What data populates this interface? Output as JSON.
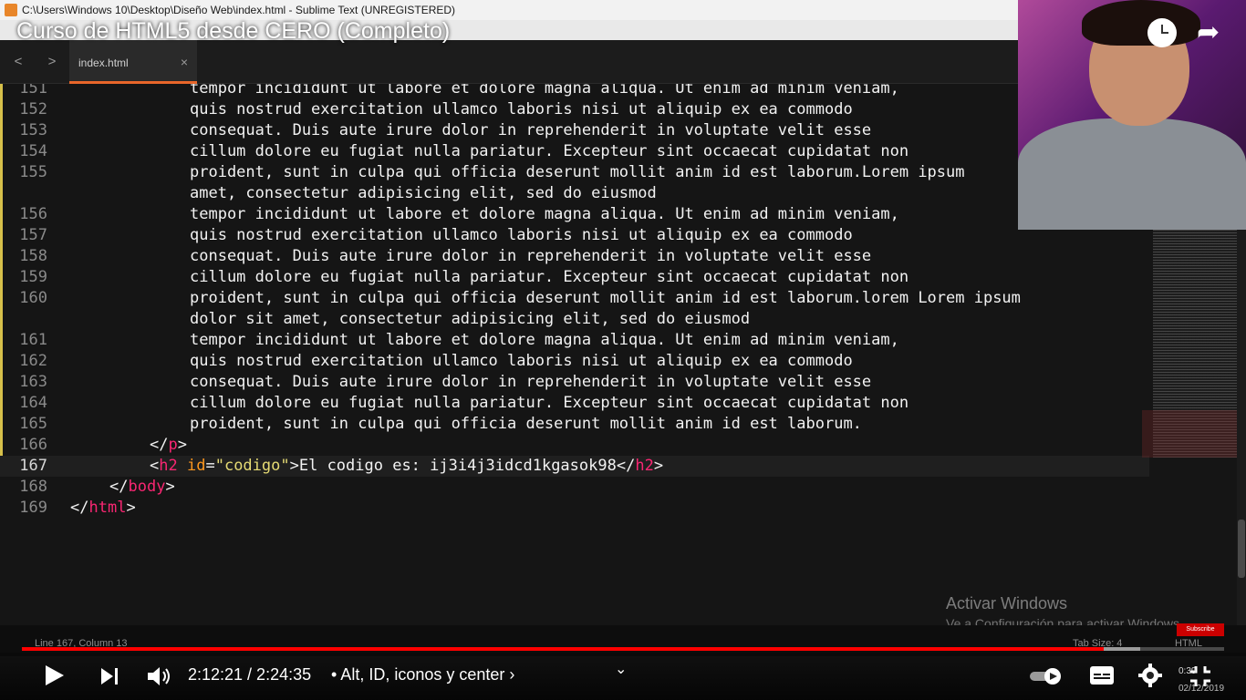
{
  "window": {
    "title": "C:\\Users\\Windows 10\\Desktop\\Diseño Web\\index.html - Sublime Text (UNREGISTERED)",
    "tab_label": "index.html",
    "tab_close": "×",
    "nav_back": "<",
    "nav_forward": ">"
  },
  "editor": {
    "lines": [
      {
        "num": "151",
        "text": "tempor incididunt ut labore et dolore magna aliqua. Ut enim ad minim veniam,"
      },
      {
        "num": "152",
        "text": "quis nostrud exercitation ullamco laboris nisi ut aliquip ex ea commodo"
      },
      {
        "num": "153",
        "text": "consequat. Duis aute irure dolor in reprehenderit in voluptate velit esse"
      },
      {
        "num": "154",
        "text": "cillum dolore eu fugiat nulla pariatur. Excepteur sint occaecat cupidatat non"
      },
      {
        "num": "155",
        "text": "proident, sunt in culpa qui officia deserunt mollit anim id est laborum.Lorem ipsum"
      },
      {
        "num": "",
        "text": "amet, consectetur adipisicing elit, sed do eiusmod"
      },
      {
        "num": "156",
        "text": "tempor incididunt ut labore et dolore magna aliqua. Ut enim ad minim veniam,"
      },
      {
        "num": "157",
        "text": "quis nostrud exercitation ullamco laboris nisi ut aliquip ex ea commodo"
      },
      {
        "num": "158",
        "text": "consequat. Duis aute irure dolor in reprehenderit in voluptate velit esse"
      },
      {
        "num": "159",
        "text": "cillum dolore eu fugiat nulla pariatur. Excepteur sint occaecat cupidatat non"
      },
      {
        "num": "160",
        "text": "proident, sunt in culpa qui officia deserunt mollit anim id est laborum.lorem Lorem ipsum"
      },
      {
        "num": "",
        "text": "dolor sit amet, consectetur adipisicing elit, sed do eiusmod"
      },
      {
        "num": "161",
        "text": "tempor incididunt ut labore et dolore magna aliqua. Ut enim ad minim veniam,"
      },
      {
        "num": "162",
        "text": "quis nostrud exercitation ullamco laboris nisi ut aliquip ex ea commodo"
      },
      {
        "num": "163",
        "text": "consequat. Duis aute irure dolor in reprehenderit in voluptate velit esse"
      },
      {
        "num": "164",
        "text": "cillum dolore eu fugiat nulla pariatur. Excepteur sint occaecat cupidatat non"
      },
      {
        "num": "165",
        "text": "proident, sunt in culpa qui officia deserunt mollit anim id est laborum."
      }
    ],
    "line166": {
      "num": "166",
      "open": "</",
      "tag": "p",
      "close": ">"
    },
    "line167": {
      "num": "167",
      "lt": "<",
      "tag": "h2",
      "attr": "id",
      "eq": "=",
      "value": "\"codigo\"",
      "gt": ">",
      "text": "El codigo es: ij3i4j3idcd1kgasok98",
      "close_lt": "</",
      "close_tag": "h2",
      "close_gt": ">"
    },
    "line168": {
      "num": "168",
      "open": "</",
      "tag": "body",
      "close": ">"
    },
    "line169": {
      "num": "169",
      "open": "</",
      "tag": "html",
      "close": ">"
    }
  },
  "status": {
    "position": "Line 167, Column 13",
    "tab_size": "Tab Size: 4",
    "syntax": "HTML"
  },
  "watermark": {
    "title": "Activar Windows",
    "subtitle": "Ve a Configuración para activar Windows."
  },
  "video": {
    "title": "Curso de HTML5 desde CERO (Completo)",
    "time": "2:12:21 / 2:24:35",
    "chapter": "• Alt, ID, iconos y center ›",
    "progress": 0.9,
    "buffered": 0.93,
    "subscribe": "Subscribe",
    "chevron": "⌄"
  },
  "taskbar": {
    "clock": "0:39",
    "date": "02/12/2019"
  },
  "colors": {
    "tag": "#f92672",
    "attr": "#fd971f",
    "string": "#e6db74",
    "progress": "#ff0000",
    "tab_accent": "#e8662a"
  }
}
